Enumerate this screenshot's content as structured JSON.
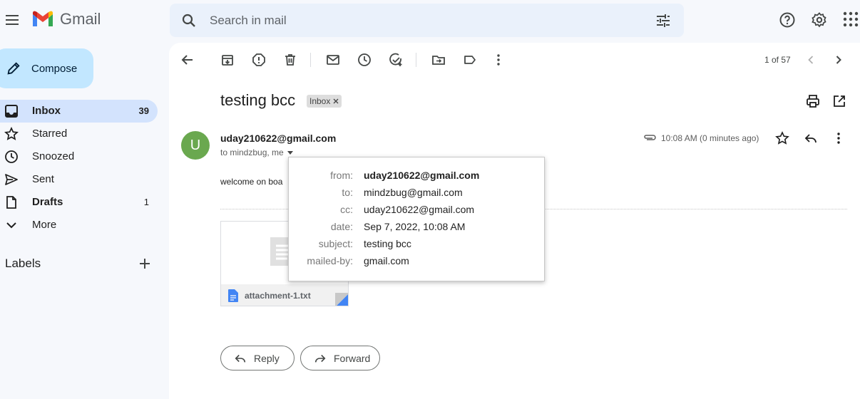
{
  "header": {
    "logo_text": "Gmail",
    "search_placeholder": "Search in mail"
  },
  "sidebar": {
    "compose_label": "Compose",
    "items": [
      {
        "label": "Inbox",
        "count": "39",
        "icon": "inbox-icon"
      },
      {
        "label": "Starred",
        "count": "",
        "icon": "star-icon"
      },
      {
        "label": "Snoozed",
        "count": "",
        "icon": "clock-icon"
      },
      {
        "label": "Sent",
        "count": "",
        "icon": "send-icon"
      },
      {
        "label": "Drafts",
        "count": "1",
        "icon": "draft-icon"
      },
      {
        "label": "More",
        "count": "",
        "icon": "chevron-down-icon"
      }
    ],
    "labels_heading": "Labels"
  },
  "toolbar": {
    "pagination": "1 of 57"
  },
  "message": {
    "subject": "testing bcc",
    "label_chip": "Inbox",
    "avatar_letter": "U",
    "sender": "uday210622@gmail.com",
    "to_line": "to mindzbug, me",
    "time": "10:08 AM (0 minutes ago)",
    "body": "welcome on boa",
    "attachment_name": "attachment-1.txt",
    "reply_label": "Reply",
    "forward_label": "Forward"
  },
  "details": {
    "from_key": "from:",
    "from_val": "uday210622@gmail.com",
    "to_key": "to:",
    "to_val": "mindzbug@gmail.com",
    "cc_key": "cc:",
    "cc_val": "uday210622@gmail.com",
    "date_key": "date:",
    "date_val": "Sep 7, 2022, 10:08 AM",
    "subject_key": "subject:",
    "subject_val": "testing bcc",
    "mailedby_key": "mailed-by:",
    "mailedby_val": "gmail.com"
  },
  "colors": {
    "compose_bg": "#c2e7ff",
    "active_nav": "#d3e3fd",
    "avatar": "#6aa84f",
    "search_bg": "#eaf1fb"
  }
}
